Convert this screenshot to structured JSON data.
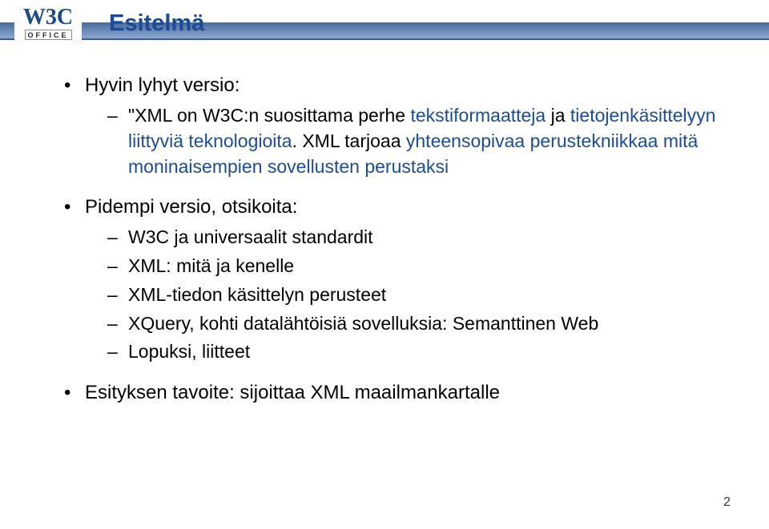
{
  "logo": {
    "w": "W",
    "three": "3",
    "c": "C",
    "subtext": "OFFICE"
  },
  "title": "Esitelmä",
  "bullets": {
    "b1": {
      "label": "Hyvin lyhyt versio:",
      "sub": {
        "s1_black": "\"XML on W3C:n suosittama perhe ",
        "s1_blue_a": "tekstiformaatteja",
        "s1_black_b": " ja ",
        "s1_blue_b": "tietojenkäsittelyyn liittyviä teknologioita",
        "s1_black_c": ". XML tarjoaa ",
        "s1_blue_c": "yhteensopivaa perustekniikkaa mitä moninaisempien sovellusten perustaksi"
      }
    },
    "b2": {
      "label": "Pidempi versio, otsikoita:",
      "items": {
        "i1": "W3C ja universaalit standardit",
        "i2": "XML: mitä ja kenelle",
        "i3": "XML-tiedon käsittelyn perusteet",
        "i4": "XQuery, kohti datalähtöisiä sovelluksia: Semanttinen Web",
        "i5": "Lopuksi, liitteet"
      }
    },
    "b3": {
      "label": "Esityksen tavoite: sijoittaa XML maailmankartalle"
    }
  },
  "pageNumber": "2"
}
